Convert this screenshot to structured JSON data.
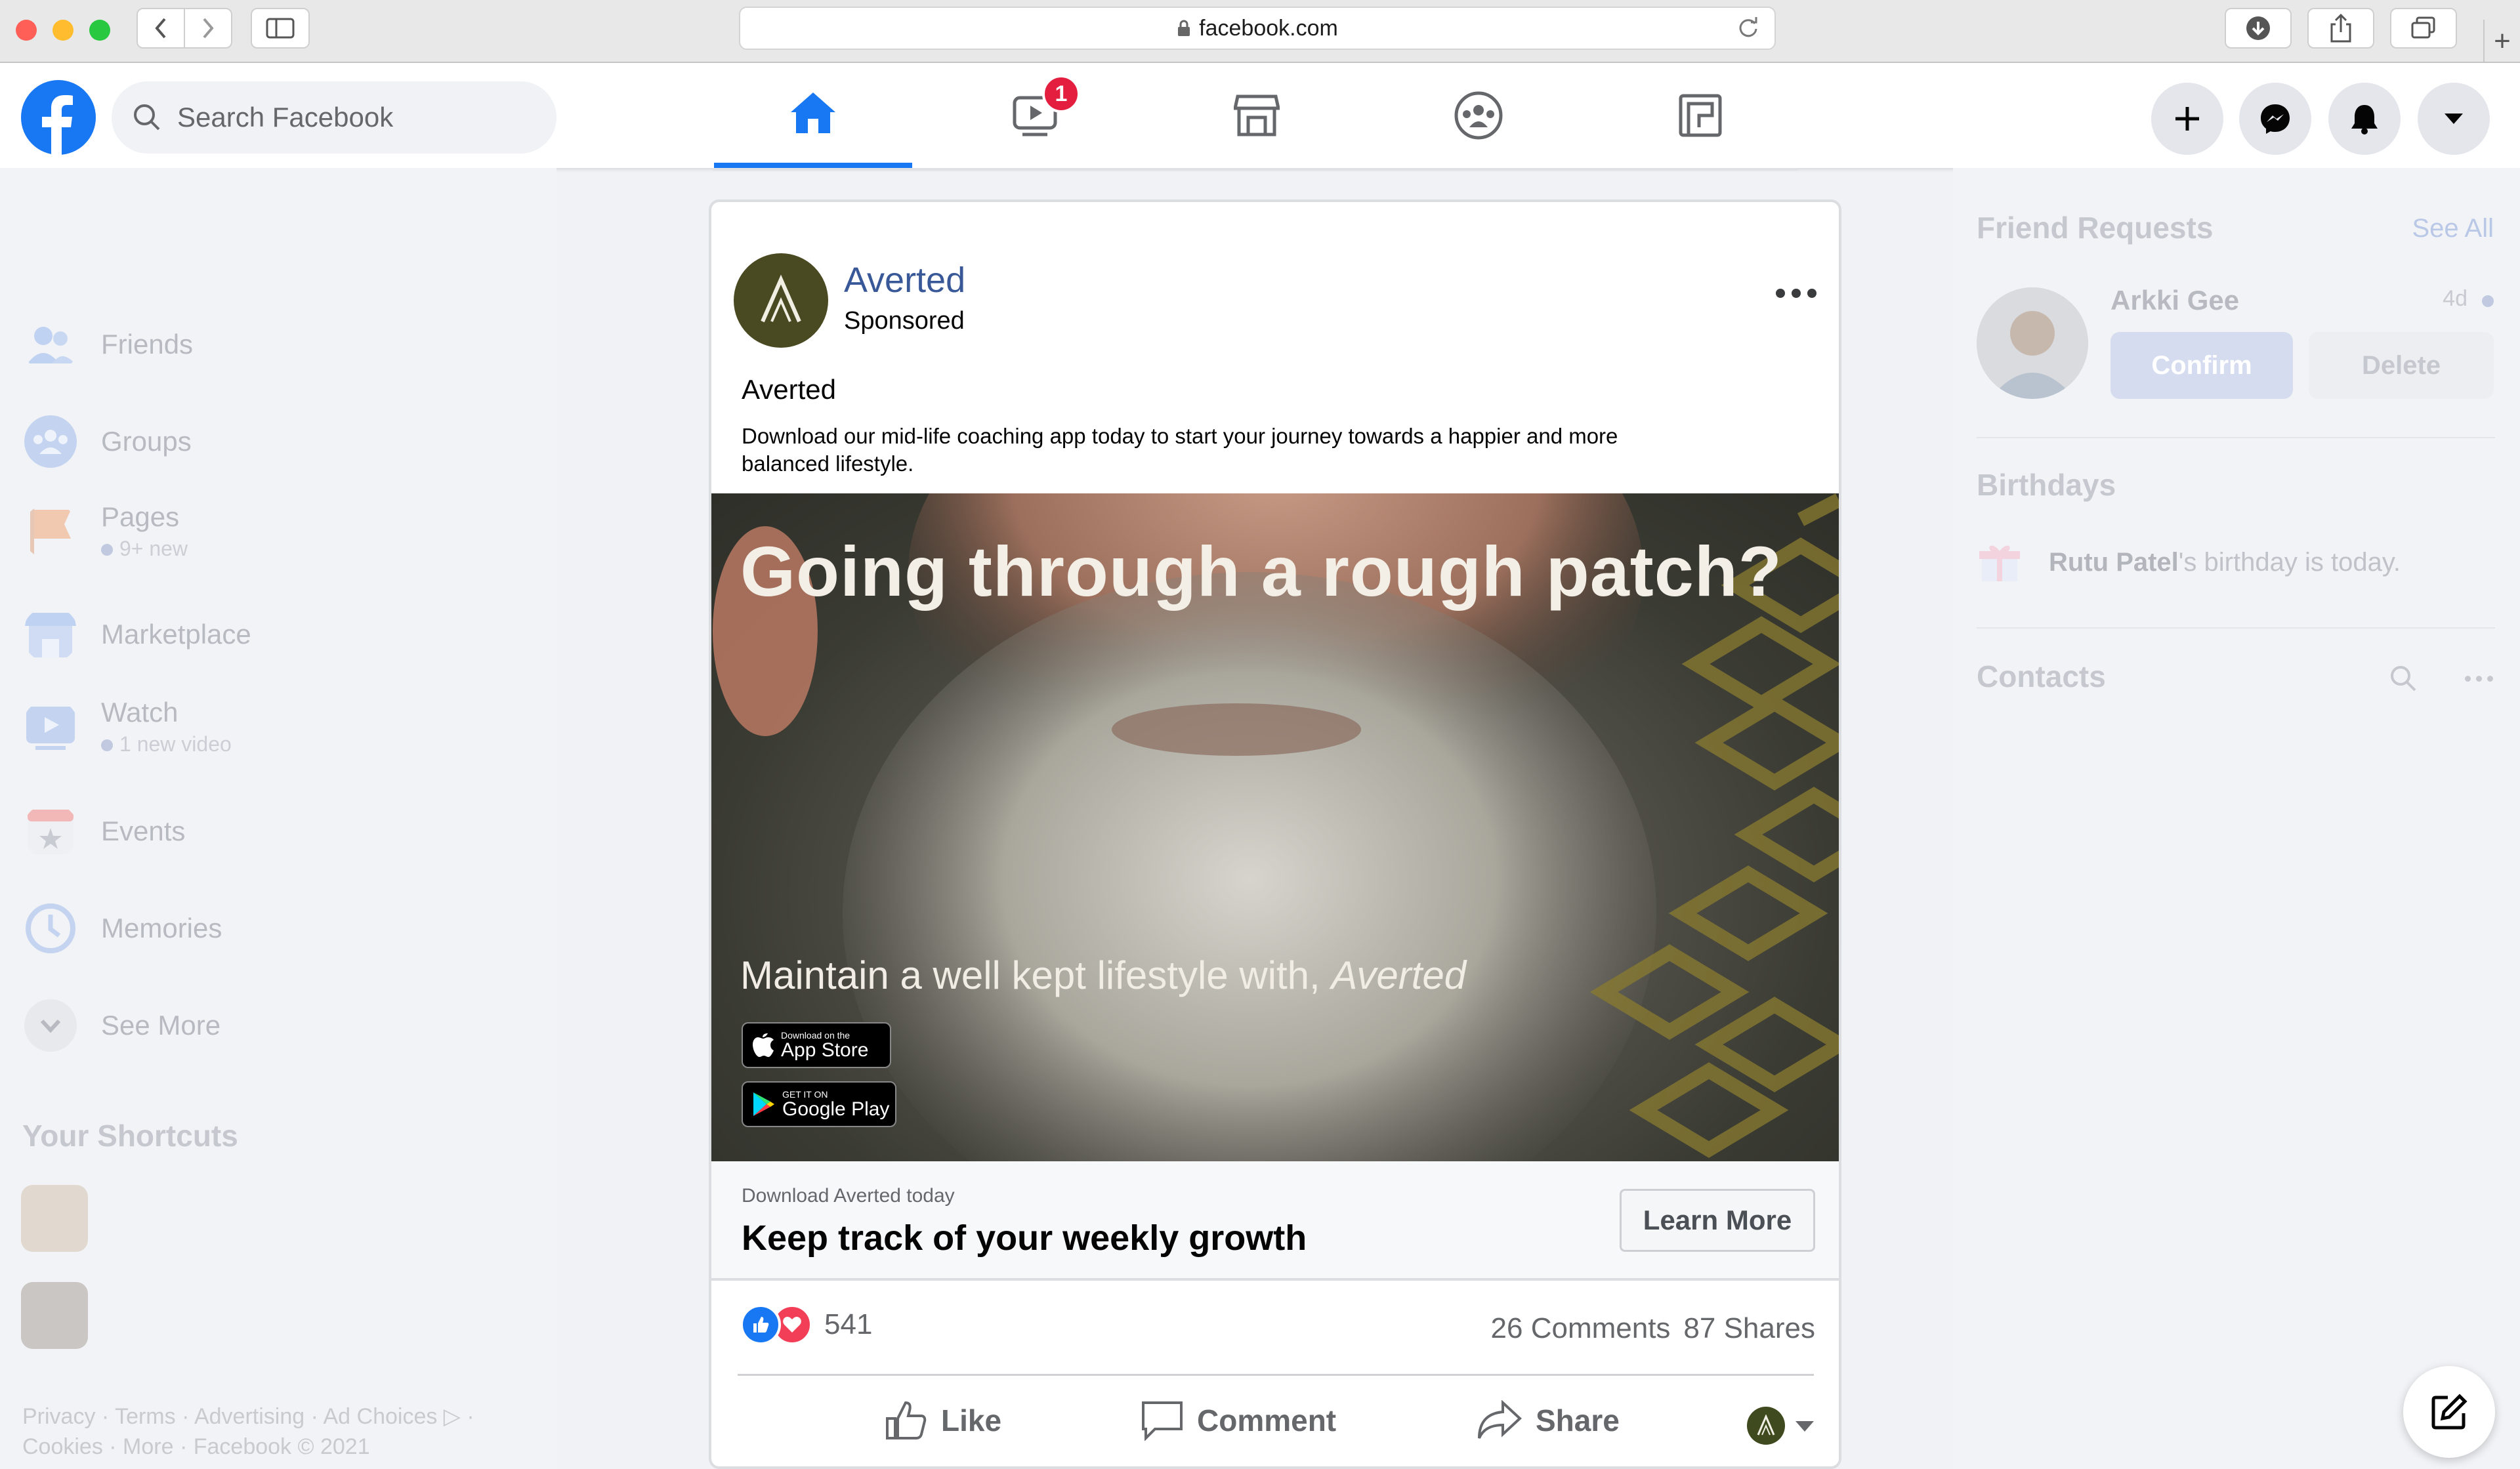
{
  "browser": {
    "url": "facebook.com"
  },
  "fb": {
    "search_placeholder": "Search Facebook",
    "watch_badge": "1",
    "brand_color": "#1877f2"
  },
  "left_nav": {
    "items": [
      {
        "label": "Friends",
        "sub": ""
      },
      {
        "label": "Groups",
        "sub": ""
      },
      {
        "label": "Pages",
        "sub": "9+ new"
      },
      {
        "label": "Marketplace",
        "sub": ""
      },
      {
        "label": "Watch",
        "sub": "1 new video"
      },
      {
        "label": "Events",
        "sub": ""
      },
      {
        "label": "Memories",
        "sub": ""
      },
      {
        "label": "See More",
        "sub": ""
      }
    ],
    "shortcuts_title": "Your Shortcuts",
    "footer": "Privacy · Terms · Advertising · Ad Choices ▷ · Cookies · More · Facebook © 2021"
  },
  "right_col": {
    "friend_requests_title": "Friend Requests",
    "see_all": "See All",
    "request": {
      "name": "Arkki Gee",
      "time": "4d",
      "confirm": "Confirm",
      "delete": "Delete"
    },
    "birthdays_title": "Birthdays",
    "birthday_name": "Rutu Patel",
    "birthday_text": "'s birthday is today.",
    "contacts_title": "Contacts"
  },
  "post": {
    "page_name": "Averted",
    "sponsored": "Sponsored",
    "title": "Averted",
    "text": "Download our mid-life coaching app today to start your journey towards a happier and more balanced lifestyle.",
    "ad_headline": "Going through a rough patch?",
    "ad_sub_prefix": "Maintain a well kept lifestyle with, ",
    "ad_sub_brand": "Averted",
    "app_store_small": "Download on the",
    "app_store_big": "App Store",
    "google_small": "GET IT ON",
    "google_big": "Google Play",
    "cta_small": "Download Averted today",
    "cta_big": "Keep track of your weekly growth",
    "cta_button": "Learn More",
    "reactions_count": "541",
    "comments": "26 Comments",
    "shares": "87 Shares",
    "actions": {
      "like": "Like",
      "comment": "Comment",
      "share": "Share"
    }
  }
}
